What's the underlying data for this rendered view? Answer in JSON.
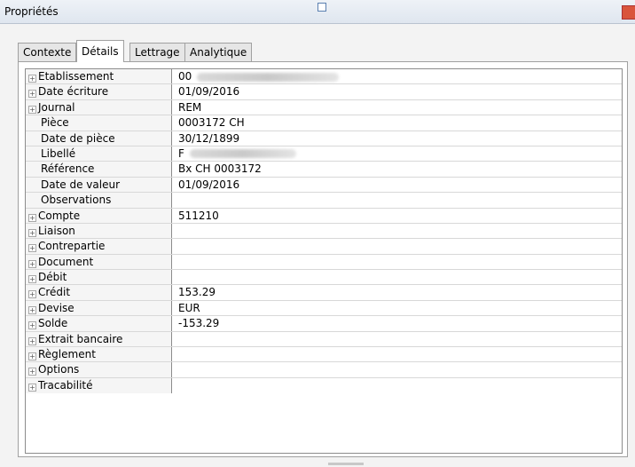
{
  "window": {
    "title": "Propriétés"
  },
  "tabs": [
    {
      "label": "Contexte",
      "active": false
    },
    {
      "label": "Détails",
      "active": true
    },
    {
      "label": "Lettrage",
      "active": false
    },
    {
      "label": "Analytique",
      "active": false
    }
  ],
  "rows": [
    {
      "label": "Etablissement",
      "expandable": true,
      "value": "00"
    },
    {
      "label": "Date écriture",
      "expandable": true,
      "value": "01/09/2016"
    },
    {
      "label": "Journal",
      "expandable": true,
      "value": "REM"
    },
    {
      "label": "Pièce",
      "expandable": false,
      "value": "0003172 CH"
    },
    {
      "label": "Date de pièce",
      "expandable": false,
      "value": "30/12/1899"
    },
    {
      "label": "Libellé",
      "expandable": false,
      "value": "F"
    },
    {
      "label": "Référence",
      "expandable": false,
      "value": "Bx CH 0003172"
    },
    {
      "label": "Date de valeur",
      "expandable": false,
      "value": "01/09/2016"
    },
    {
      "label": "Observations",
      "expandable": false,
      "value": ""
    },
    {
      "label": "Compte",
      "expandable": true,
      "value": "511210"
    },
    {
      "label": "Liaison",
      "expandable": true,
      "value": ""
    },
    {
      "label": "Contrepartie",
      "expandable": true,
      "value": ""
    },
    {
      "label": "Document",
      "expandable": true,
      "value": ""
    },
    {
      "label": "Débit",
      "expandable": true,
      "value": ""
    },
    {
      "label": "Crédit",
      "expandable": true,
      "value": "153.29"
    },
    {
      "label": "Devise",
      "expandable": true,
      "value": "EUR"
    },
    {
      "label": "Solde",
      "expandable": true,
      "value": "-153.29"
    },
    {
      "label": "Extrait bancaire",
      "expandable": true,
      "value": ""
    },
    {
      "label": "Règlement",
      "expandable": true,
      "value": ""
    },
    {
      "label": "Options",
      "expandable": true,
      "value": ""
    },
    {
      "label": "Tracabilité",
      "expandable": true,
      "value": ""
    }
  ]
}
